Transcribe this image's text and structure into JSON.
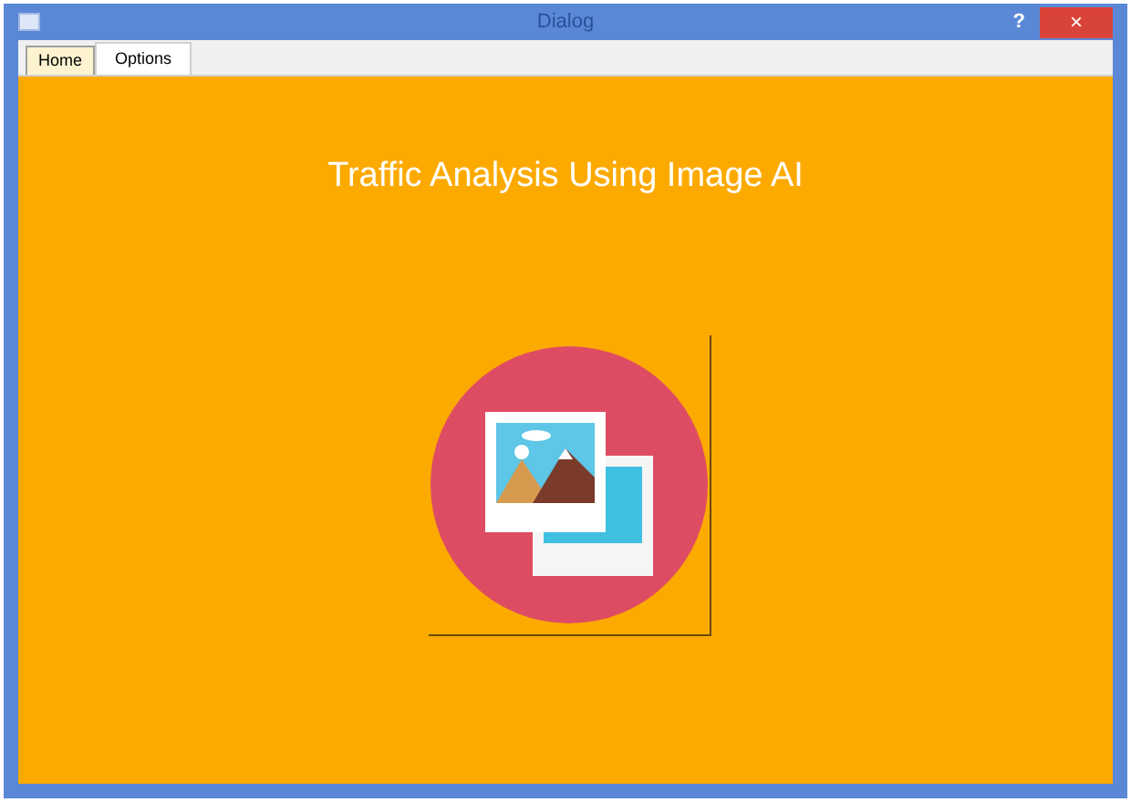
{
  "window": {
    "title": "Dialog",
    "help": "?",
    "close": "×"
  },
  "tabs": [
    {
      "label": "Home",
      "selected": true
    },
    {
      "label": "Options",
      "selected": false
    }
  ],
  "heading": "Traffic Analysis Using Image AI"
}
